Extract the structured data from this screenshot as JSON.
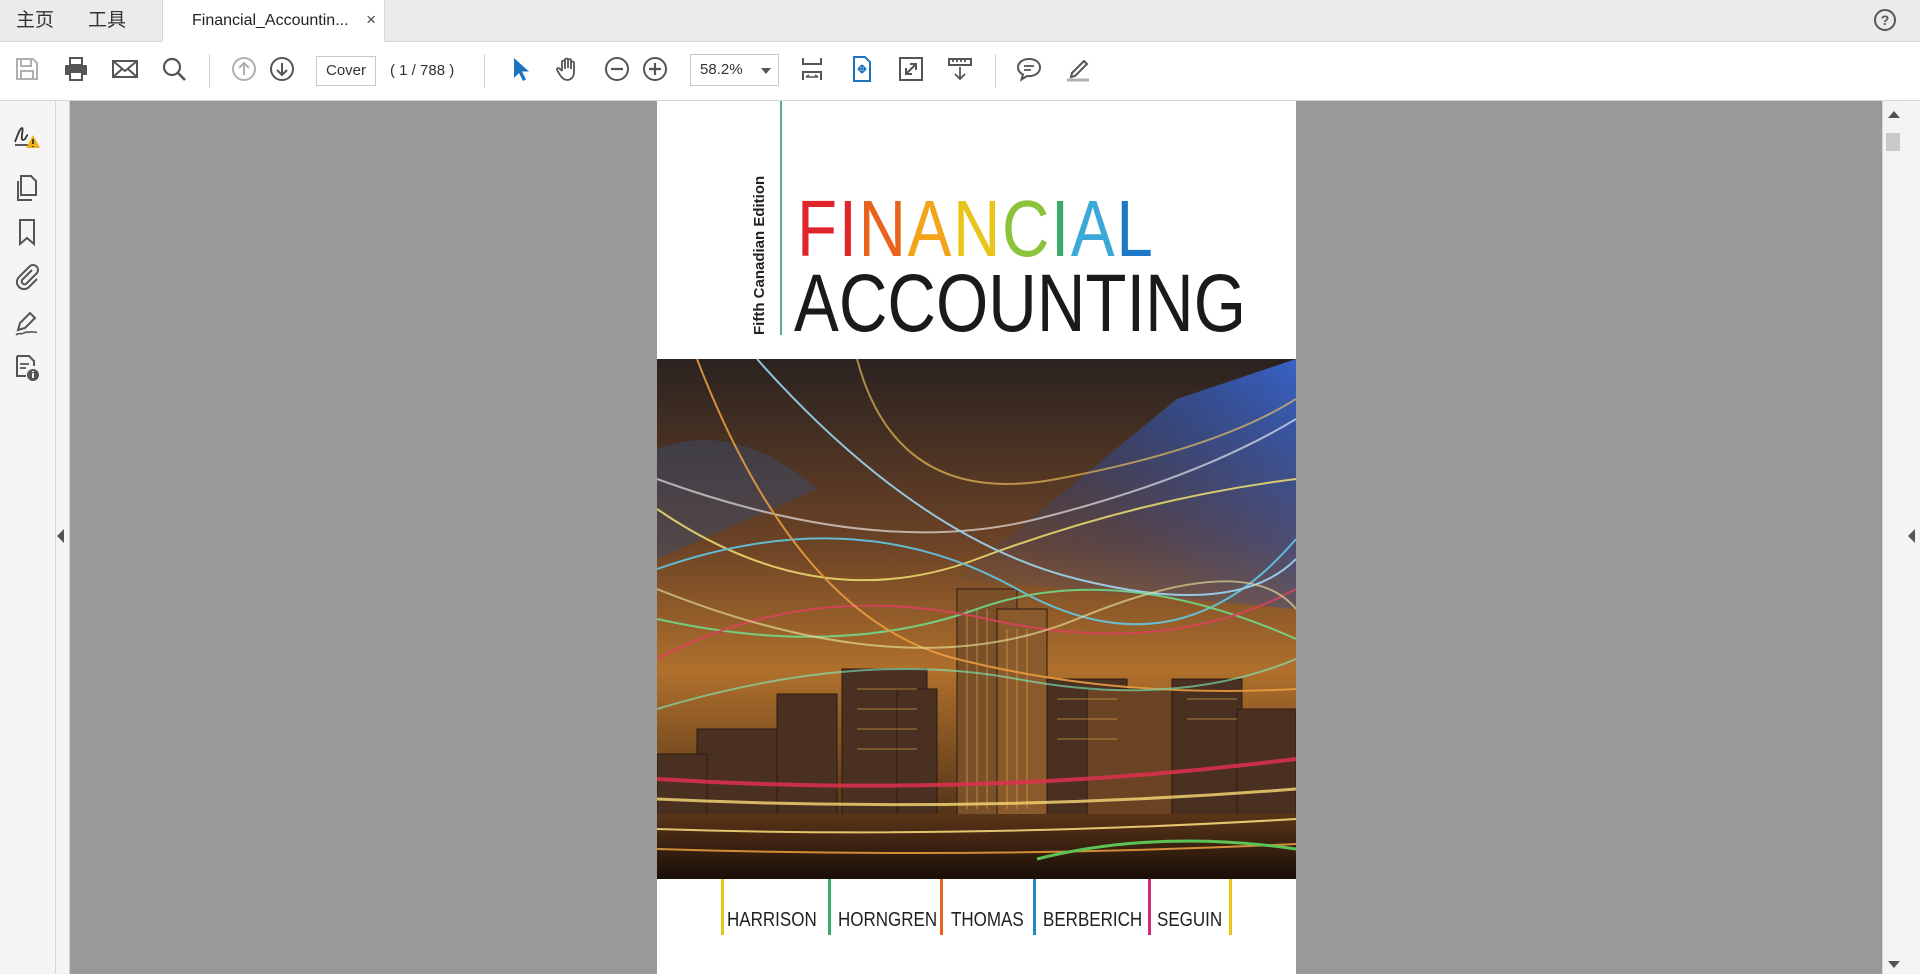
{
  "tabbar": {
    "home_label": "主页",
    "tools_label": "工具",
    "document_tab": "Financial_Accountin...",
    "close_glyph": "×",
    "help_glyph": "?"
  },
  "toolbar": {
    "page_input": "Cover",
    "page_count": "( 1 / 788 )",
    "zoom": "58.2%",
    "icons": [
      "save-icon",
      "print-icon",
      "email-icon",
      "search-icon",
      "previous-page-icon",
      "next-page-icon",
      "select-cursor-icon",
      "hand-tool-icon",
      "zoom-out-icon",
      "zoom-in-icon",
      "scroll-mode-icon",
      "fit-page-icon",
      "full-screen-icon",
      "read-mode-icon",
      "comment-icon",
      "highlight-pen-icon"
    ]
  },
  "leftnav": {
    "icons": [
      "signature-warning-icon",
      "page-thumbnails-icon",
      "bookmark-icon",
      "attachment-icon",
      "fill-sign-icon",
      "document-properties-icon"
    ]
  },
  "cover": {
    "edition": "Fifth Canadian Edition",
    "title_letters": [
      {
        "ch": "F",
        "color": "#e0242c"
      },
      {
        "ch": "I",
        "color": "#e0242c"
      },
      {
        "ch": "N",
        "color": "#e8641c"
      },
      {
        "ch": "A",
        "color": "#f2a51a"
      },
      {
        "ch": "N",
        "color": "#e8c51a"
      },
      {
        "ch": "C",
        "color": "#8bc43a"
      },
      {
        "ch": "I",
        "color": "#3aaa6a"
      },
      {
        "ch": "A",
        "color": "#3aa8d8"
      },
      {
        "ch": "L",
        "color": "#1e78c8"
      }
    ],
    "title_line2": "ACCOUNTING",
    "authors": [
      {
        "name": "HARRISON",
        "bar_color": "#e8c51a"
      },
      {
        "name": "HORNGREN",
        "bar_color": "#3aaa6a"
      },
      {
        "name": "THOMAS",
        "bar_color": "#e8641c"
      },
      {
        "name": "BERBERICH",
        "bar_color": "#1e88c8"
      },
      {
        "name": "SEGUIN",
        "bar_color": "#d8287a"
      }
    ],
    "last_bar_color": "#e8c51a",
    "accent_line_color": "#5aaa88"
  },
  "colors": {
    "viewer_bg": "#999999",
    "accent_blue": "#1e73be"
  }
}
